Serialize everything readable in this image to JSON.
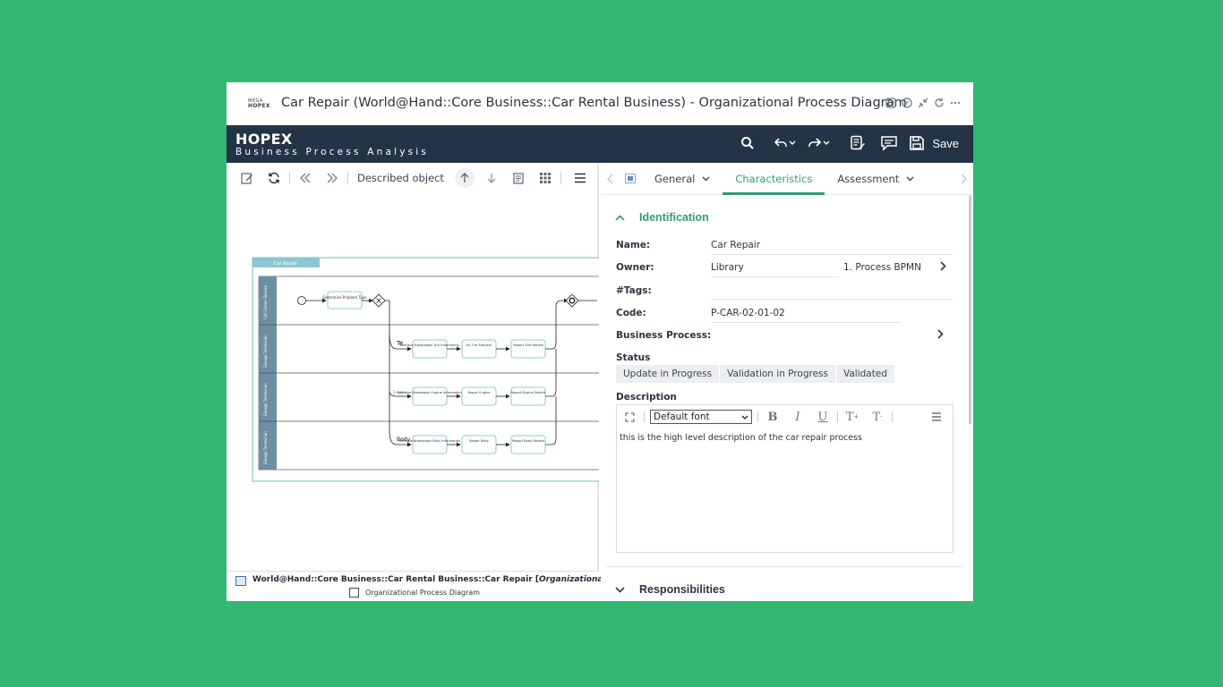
{
  "window": {
    "title": "Car Repair (World@Hand::Core Business::Car Rental Business) - Organizational Process Diagram",
    "logo_line1": "MEGA",
    "logo_line2": "HOPEX"
  },
  "header": {
    "brand": "HOPEX",
    "subtitle": "Business Process Analysis",
    "save_label": "Save"
  },
  "left_toolbar": {
    "described_object": "Described object"
  },
  "diagram": {
    "title": "Car Repair",
    "lanes": [
      "Call Center Service",
      "Garage Technician",
      "Garage Technician",
      "Garage Technician"
    ],
    "tasks": {
      "determine": "Determine Problem Type",
      "ret_tire": "Retrieve Breakdown Tire Information",
      "fix_tire": "Fix Tire Problem",
      "rep_tire": "Report Tire Details",
      "ret_engine": "Retrieve Breakdown Engine Information",
      "repair_engine": "Repair Engine",
      "rep_engine": "Report Engine Details",
      "ret_body": "Retrieve Breakdown Body Information",
      "repair_body": "Repair Body",
      "rep_body": "Report Body Details"
    },
    "flow_labels": {
      "tire": "Te",
      "engine": "Engine",
      "body": "Body"
    }
  },
  "footer": {
    "path": "World@Hand::Core Business::Car Rental Business::Car Repair [",
    "path_type": "Organizational Process",
    "path_end": "]",
    "sub": "Organizational Process Diagram"
  },
  "tabs": [
    {
      "label": "General"
    },
    {
      "label": "Characteristics"
    },
    {
      "label": "Assessment"
    }
  ],
  "identification": {
    "heading": "Identification",
    "name_label": "Name:",
    "name_value": "Car Repair",
    "owner_label": "Owner:",
    "owner_value": "Library",
    "owner_value2": "1. Process BPMN",
    "tags_label": "#Tags:",
    "code_label": "Code:",
    "code_value": "P-CAR-02-01-02",
    "bp_label": "Business Process:",
    "status_label": "Status",
    "status_options": [
      "Update in Progress",
      "Validation in Progress",
      "Validated"
    ],
    "description_label": "Description",
    "font_select": "Default font",
    "description_text": "this is the high level description of the car repair process"
  },
  "responsibilities": {
    "heading": "Responsibilities"
  },
  "colors": {
    "background": "#33b873",
    "header": "#243447",
    "accent": "#2f9e6f",
    "diagram_accent": "#6bbcc8"
  }
}
